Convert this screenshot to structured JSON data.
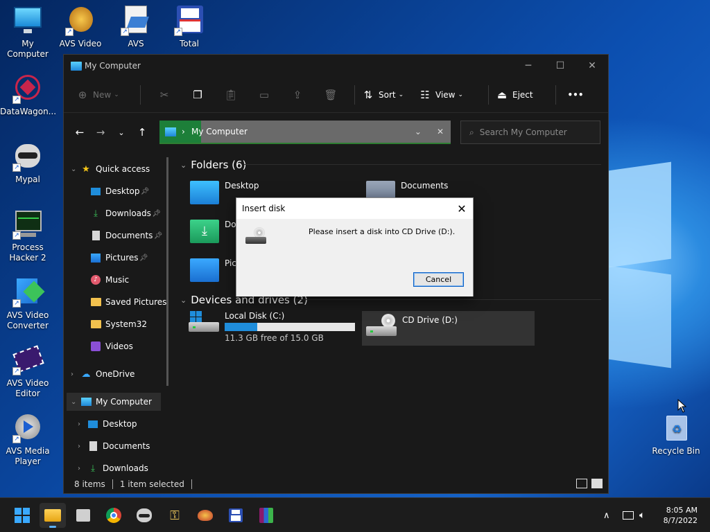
{
  "desktop": {
    "icons": [
      {
        "label": "My Computer",
        "icon": "monitor-icon"
      },
      {
        "label": "AVS Video ReMaker",
        "icon": "avs-remaker-icon"
      },
      {
        "label": "AVS Document",
        "icon": "avs-document-icon"
      },
      {
        "label": "Total Commander",
        "icon": "floppy-icon"
      },
      {
        "label": "DataWagon...",
        "icon": "datawagon-icon"
      },
      {
        "label": "Mypal",
        "icon": "raccoon-icon"
      },
      {
        "label": "Process Hacker 2",
        "icon": "process-hacker-icon"
      },
      {
        "label": "AVS Video Converter",
        "icon": "avs-converter-icon"
      },
      {
        "label": "AVS Video Editor",
        "icon": "avs-editor-icon"
      },
      {
        "label": "AVS Media Player",
        "icon": "avs-player-icon"
      },
      {
        "label": "Recycle Bin",
        "icon": "recycle-bin-icon"
      }
    ]
  },
  "explorer": {
    "title": "My Computer",
    "controls": {
      "minimize": "─",
      "maximize": "☐",
      "close": "✕"
    },
    "toolbar": {
      "new_label": "New",
      "sort_label": "Sort",
      "view_label": "View",
      "eject_label": "Eject",
      "more_label": "•••"
    },
    "address": {
      "path": "My Computer",
      "search_placeholder": "Search My Computer"
    },
    "sidebar": {
      "quick_access": "Quick access",
      "quick_items": [
        {
          "label": "Desktop",
          "pinned": true
        },
        {
          "label": "Downloads",
          "pinned": true
        },
        {
          "label": "Documents",
          "pinned": true
        },
        {
          "label": "Pictures",
          "pinned": true
        },
        {
          "label": "Music",
          "pinned": false
        },
        {
          "label": "Saved Pictures",
          "pinned": false
        },
        {
          "label": "System32",
          "pinned": false
        },
        {
          "label": "Videos",
          "pinned": false
        }
      ],
      "onedrive": "OneDrive",
      "my_computer": "My Computer",
      "computer_items": [
        "Desktop",
        "Documents",
        "Downloads"
      ]
    },
    "content": {
      "folders_header": "Folders (6)",
      "folders": [
        "Desktop",
        "Documents",
        "Downloads",
        "Pictures"
      ],
      "folders_visible_partial": {
        "downloads": "Do",
        "pictures": "Pic"
      },
      "drives_header": "Devices and drives (2)",
      "drives": [
        {
          "name": "Local Disk (C:)",
          "free_text": "11.3 GB free of 15.0 GB",
          "used_fraction": 0.25
        },
        {
          "name": "CD Drive (D:)"
        }
      ]
    },
    "status": {
      "items": "8 items",
      "selected": "1 item selected"
    }
  },
  "dialog": {
    "title": "Insert disk",
    "message": "Please insert a disk into CD Drive (D:).",
    "cancel_label": "Cancel",
    "close": "✕"
  },
  "taskbar": {
    "time": "8:05 AM",
    "date": "8/7/2022",
    "chevron": "∧"
  },
  "colors": {
    "accent": "#1f8ddb",
    "address_green": "#1d7f39",
    "window_bg": "#191919"
  }
}
